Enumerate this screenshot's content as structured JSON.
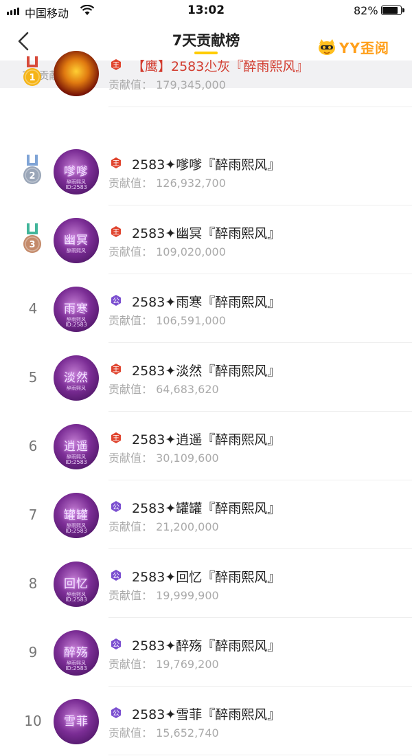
{
  "status_bar": {
    "carrier": "中国移动",
    "time": "13:02",
    "battery": "82%",
    "battery_level": 0.82
  },
  "header": {
    "title": "7天贡献榜",
    "back_icon": "chevron-left-icon",
    "watermark": "YY歪阅"
  },
  "section": {
    "label": "7天贡献榜"
  },
  "value_label": "贡献值：",
  "list": [
    {
      "rank": "1",
      "medal": "gold",
      "badge": "king",
      "name": "【鹰】2583尐灰『醉雨熙风』",
      "value": "179,345,000",
      "avatar_text": "",
      "avatar_sub": "",
      "avatar_id": ""
    },
    {
      "rank": "2",
      "medal": "silver",
      "badge": "king",
      "name": "2583✦嗲嗲『醉雨熙风』",
      "value": "126,932,700",
      "avatar_text": "嗲嗲",
      "avatar_sub": "醉雨熙风",
      "avatar_id": "ID:2583"
    },
    {
      "rank": "3",
      "medal": "bronze",
      "badge": "king",
      "name": "2583✦幽冥『醉雨熙风』",
      "value": "109,020,000",
      "avatar_text": "幽冥",
      "avatar_sub": "醉雨熙风",
      "avatar_id": ""
    },
    {
      "rank": "4",
      "medal": "",
      "badge": "duke",
      "name": "2583✦雨寒『醉雨熙风』",
      "value": "106,591,000",
      "avatar_text": "雨寒",
      "avatar_sub": "醉雨熙风",
      "avatar_id": "ID:2583"
    },
    {
      "rank": "5",
      "medal": "",
      "badge": "king",
      "name": "2583✦淡然『醉雨熙风』",
      "value": "64,683,620",
      "avatar_text": "淡然",
      "avatar_sub": "醉雨熙风",
      "avatar_id": ""
    },
    {
      "rank": "6",
      "medal": "",
      "badge": "king",
      "name": "2583✦逍遥『醉雨熙风』",
      "value": "30,109,600",
      "avatar_text": "逍遥",
      "avatar_sub": "醉雨熙风",
      "avatar_id": "ID:2583"
    },
    {
      "rank": "7",
      "medal": "",
      "badge": "duke",
      "name": "2583✦罐罐『醉雨熙风』",
      "value": "21,200,000",
      "avatar_text": "罐罐",
      "avatar_sub": "醉雨熙风",
      "avatar_id": "ID:2583"
    },
    {
      "rank": "8",
      "medal": "",
      "badge": "duke",
      "name": "2583✦回忆『醉雨熙风』",
      "value": "19,999,900",
      "avatar_text": "回忆",
      "avatar_sub": "醉雨熙风",
      "avatar_id": "ID:2583"
    },
    {
      "rank": "9",
      "medal": "",
      "badge": "duke",
      "name": "2583✦醉殇『醉雨熙风』",
      "value": "19,769,200",
      "avatar_text": "醉殇",
      "avatar_sub": "醉雨熙风",
      "avatar_id": "ID:2583"
    },
    {
      "rank": "10",
      "medal": "",
      "badge": "duke",
      "name": "2583✦雪菲『醉雨熙风』",
      "value": "15,652,740",
      "avatar_text": "雪菲",
      "avatar_sub": "",
      "avatar_id": ""
    }
  ],
  "colors": {
    "accent": "#ffcc00",
    "badge_king": "#e0452f",
    "badge_duke": "#7b4fd0",
    "medal_gold": "#f5b417",
    "medal_silver": "#9aa6b8",
    "medal_bronze": "#c48a6a"
  }
}
